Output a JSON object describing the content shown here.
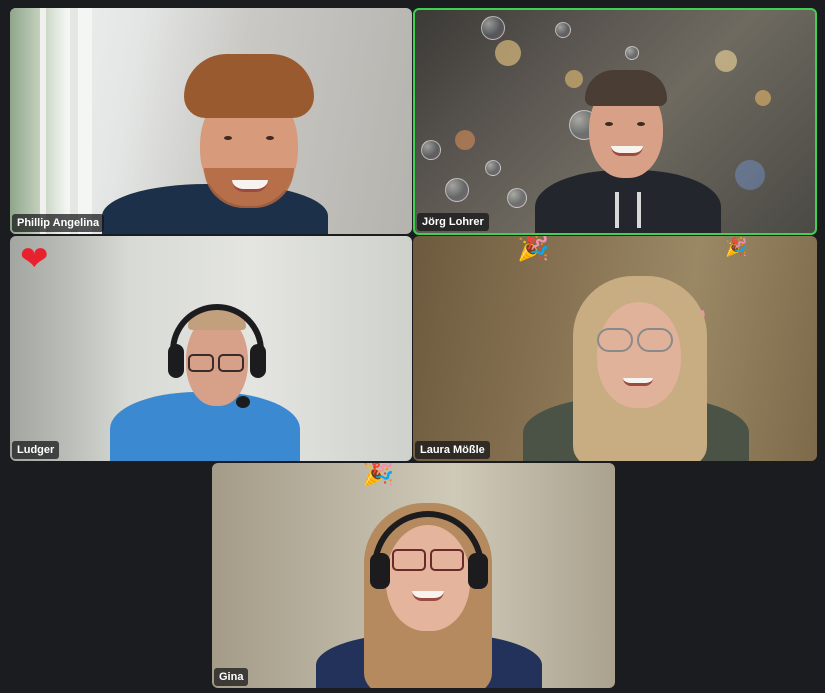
{
  "participants": [
    {
      "name": "Phillip Angelina"
    },
    {
      "name": "Jörg Lohrer",
      "active_speaker": true
    },
    {
      "name": "Ludger"
    },
    {
      "name": "Laura Mößle"
    },
    {
      "name": "Gina"
    }
  ],
  "reactions": {
    "heart": "❤",
    "party": "🎉"
  },
  "colors": {
    "background": "#1b1c1f",
    "active_speaker_border": "#3fd14f",
    "heart": "#e8212e"
  }
}
